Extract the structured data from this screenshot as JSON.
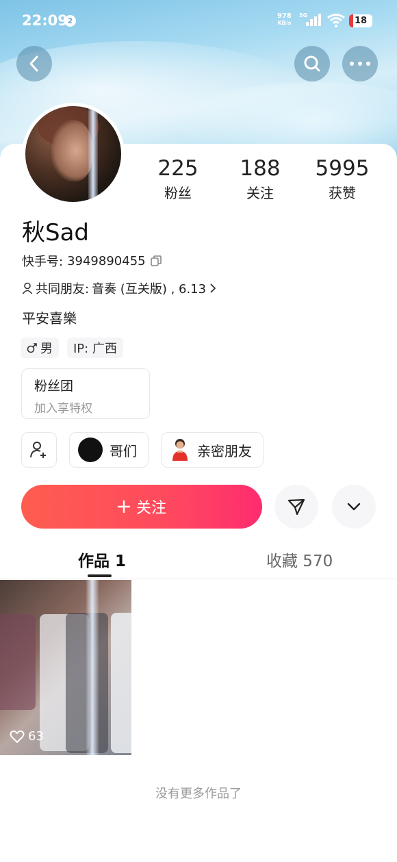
{
  "status_bar": {
    "time": "22:09",
    "notification_count": "2",
    "net_speed_value": "978",
    "net_speed_unit": "KB/s",
    "network_type": "5G",
    "battery": "18"
  },
  "header": {
    "back_icon": "chevron-left-icon",
    "search_icon": "search-icon",
    "more_icon": "more-horizontal-icon"
  },
  "profile": {
    "stats": [
      {
        "value": "225",
        "label": "粉丝"
      },
      {
        "value": "188",
        "label": "关注"
      },
      {
        "value": "5995",
        "label": "获赞"
      }
    ],
    "name": "秋Sad",
    "kuaishou_id_label": "快手号:",
    "kuaishou_id": "3949890455",
    "mutual_friends_label": "共同朋友:",
    "mutual_friends": "音奏 (互关版) , 6.13",
    "bio": "平安喜樂",
    "tags": {
      "gender": "男",
      "ip": "IP:  广西"
    },
    "fan_club": {
      "title": "粉丝团",
      "subtitle": "加入享特权"
    },
    "chips": [
      {
        "label": "哥们"
      },
      {
        "label": "亲密朋友"
      }
    ]
  },
  "actions": {
    "follow_label": "关注"
  },
  "tabs": [
    {
      "label": "作品 1",
      "active": true
    },
    {
      "label": "收藏 570",
      "active": false
    }
  ],
  "works": [
    {
      "likes": "63"
    }
  ],
  "footer": {
    "no_more": "没有更多作品了"
  },
  "colors": {
    "follow_gradient_start": "#ff5d50",
    "follow_gradient_end": "#fe2c6f",
    "header_sky": "#a7dbf2"
  }
}
